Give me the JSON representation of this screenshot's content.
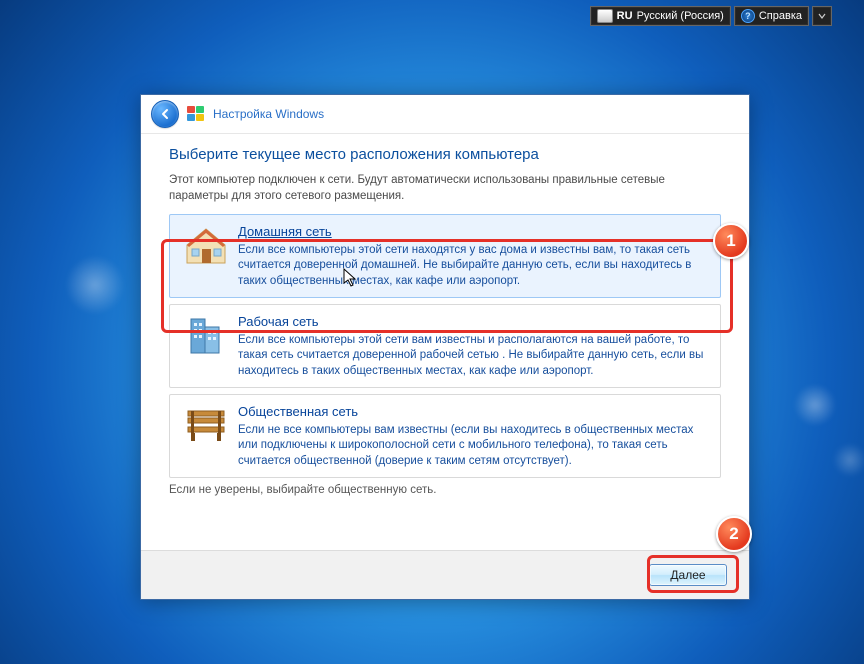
{
  "topbar": {
    "lang_code": "RU",
    "lang_name": "Русский (Россия)",
    "help_label": "Справка"
  },
  "window": {
    "title": "Настройка Windows",
    "main_title": "Выберите текущее место расположения компьютера",
    "intro": "Этот компьютер подключен к сети. Будут автоматически использованы правильные сетевые параметры для этого сетевого размещения.",
    "hint": "Если не уверены, выбирайте общественную сеть.",
    "next_label": "Далее"
  },
  "options": [
    {
      "title": "Домашняя сеть",
      "desc": "Если все компьютеры этой сети находятся у вас дома и известны вам, то такая сеть считается доверенной домашней. Не выбирайте данную сеть, если вы находитесь в таких общественных местах, как кафе или аэропорт.",
      "hover": true
    },
    {
      "title": "Рабочая сеть",
      "desc": "Если все компьютеры этой сети вам известны и располагаются на вашей работе, то такая сеть считается доверенной рабочей сетью . Не выбирайте данную сеть, если вы находитесь в таких общественных местах, как кафе или аэропорт.",
      "hover": false
    },
    {
      "title": "Общественная сеть",
      "desc": "Если не все компьютеры вам известны (если вы находитесь в общественных местах или подключены к широкополосной сети с мобильного телефона), то такая сеть считается общественной (доверие к таким сетям отсутствует).",
      "hover": false
    }
  ],
  "annotations": {
    "badge1": "1",
    "badge2": "2"
  }
}
